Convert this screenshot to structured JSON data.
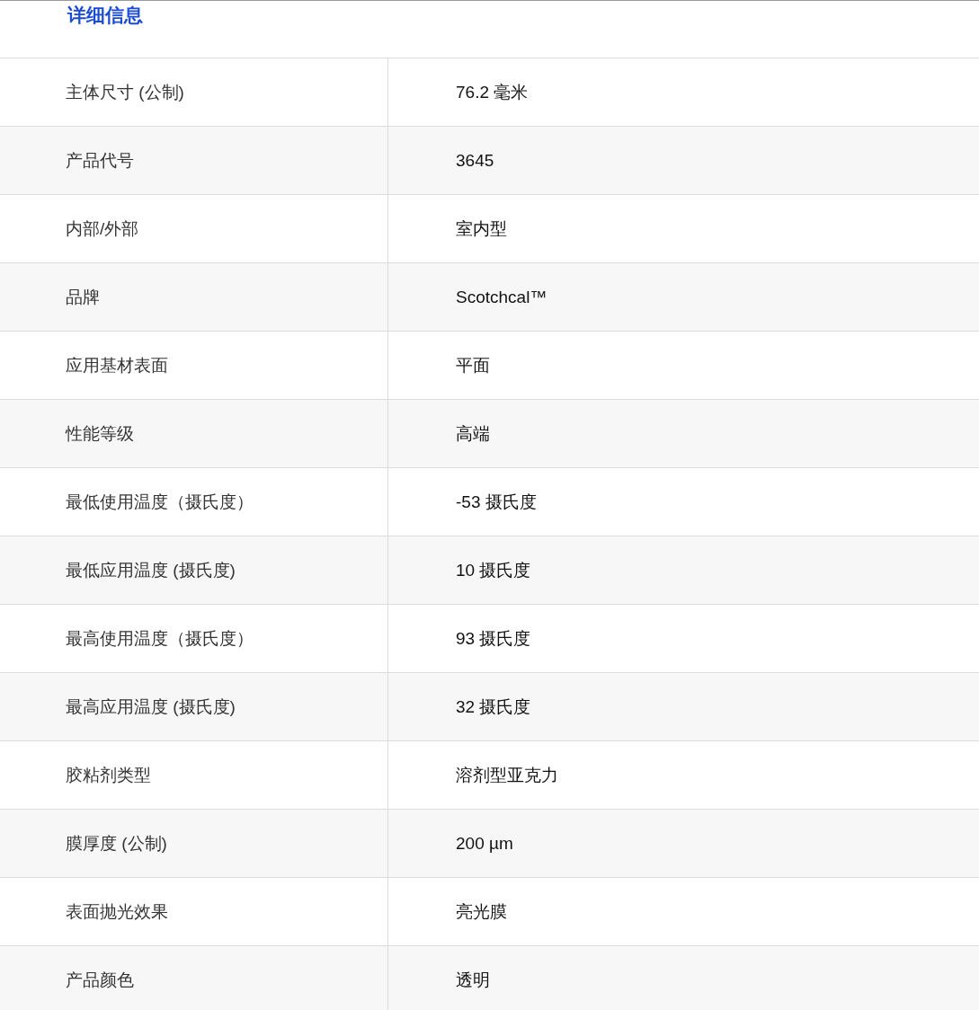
{
  "title": "详细信息",
  "rows": [
    {
      "label": "主体尺寸 (公制)",
      "value": "76.2 毫米"
    },
    {
      "label": "产品代号",
      "value": "3645"
    },
    {
      "label": "内部/外部",
      "value": "室内型"
    },
    {
      "label": "品牌",
      "value": "Scotchcal™"
    },
    {
      "label": "应用基材表面",
      "value": "平面"
    },
    {
      "label": "性能等级",
      "value": "高端"
    },
    {
      "label": "最低使用温度（摄氏度）",
      "value": "-53 摄氏度"
    },
    {
      "label": "最低应用温度 (摄氏度)",
      "value": "10 摄氏度"
    },
    {
      "label": "最高使用温度（摄氏度）",
      "value": "93 摄氏度"
    },
    {
      "label": "最高应用温度 (摄氏度)",
      "value": "32 摄氏度"
    },
    {
      "label": "胶粘剂类型",
      "value": "溶剂型亚克力"
    },
    {
      "label": "膜厚度 (公制)",
      "value": "200 µm"
    },
    {
      "label": "表面抛光效果",
      "value": "亮光膜"
    },
    {
      "label": "产品颜色",
      "value": "透明"
    }
  ]
}
